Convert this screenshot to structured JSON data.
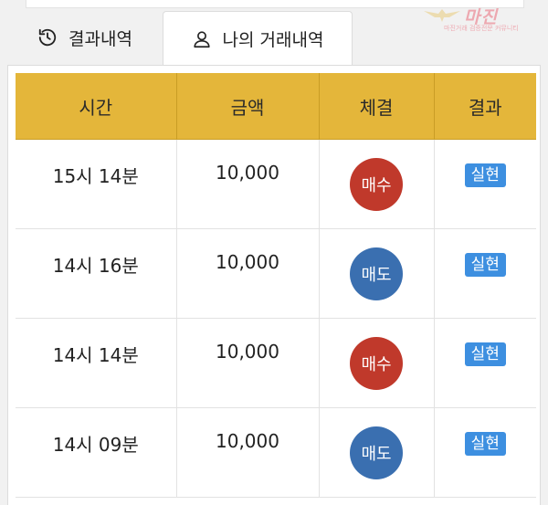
{
  "colors": {
    "header_bg": "#e4b63a",
    "buy": "#c0392b",
    "sell": "#3a6fb0",
    "badge": "#3d8fe0"
  },
  "tabs": [
    {
      "label": "결과내역",
      "icon": "history-icon",
      "active": false
    },
    {
      "label": "나의 거래내역",
      "icon": "user-icon",
      "active": true
    }
  ],
  "watermark": {
    "text": "마진",
    "sub": "마진거래 검증전문 커뮤니티"
  },
  "table": {
    "headers": [
      "시간",
      "금액",
      "체결",
      "결과"
    ],
    "rows": [
      {
        "time": "15시 14분",
        "amount": "10,000",
        "execution": "매수",
        "type": "buy",
        "result": "실현"
      },
      {
        "time": "14시 16분",
        "amount": "10,000",
        "execution": "매도",
        "type": "sell",
        "result": "실현"
      },
      {
        "time": "14시 14분",
        "amount": "10,000",
        "execution": "매수",
        "type": "buy",
        "result": "실현"
      },
      {
        "time": "14시 09분",
        "amount": "10,000",
        "execution": "매도",
        "type": "sell",
        "result": "실현"
      }
    ]
  }
}
